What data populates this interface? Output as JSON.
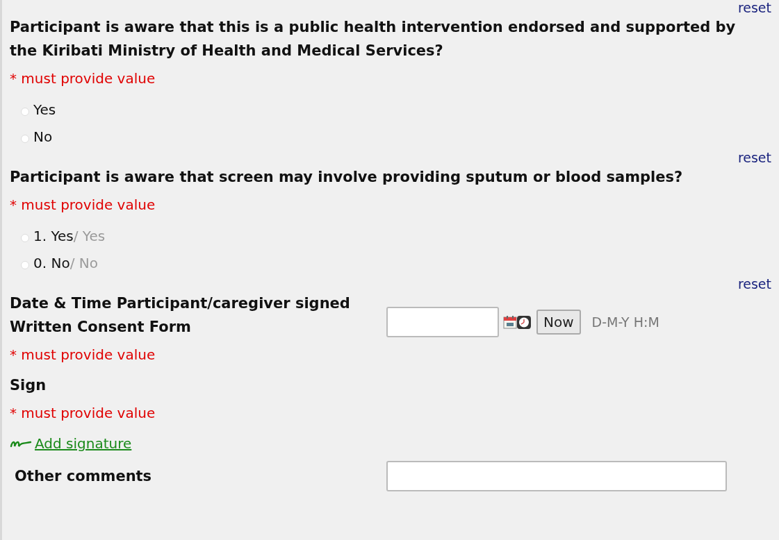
{
  "questions": [
    {
      "reset": "reset",
      "label": "Participant is aware that this is a public health intervention endorsed and supported by the Kiribati Ministry of Health and Medical Services?",
      "required": "* must provide value",
      "options": [
        {
          "label": "Yes",
          "selected": false
        },
        {
          "label": "No",
          "selected": false
        }
      ]
    },
    {
      "reset": "reset",
      "label": "Participant is aware that screen may involve providing sputum or blood samples?",
      "required": "* must provide value",
      "options": [
        {
          "label": "1. Yes",
          "translation": "/ Yes",
          "selected": false
        },
        {
          "label": "0. No",
          "translation": "/ No",
          "selected": false
        }
      ]
    }
  ],
  "datetime": {
    "reset": "reset",
    "label_lines": [
      "Date & Time Participant/caregiver signed",
      "Written Consent Form"
    ],
    "required": "* must provide value",
    "now_button": "Now",
    "format": "D-M-Y H:M"
  },
  "sign": {
    "label": "Sign",
    "required": "* must provide value",
    "link": "Add signature"
  },
  "comments": {
    "label": "Other comments"
  }
}
